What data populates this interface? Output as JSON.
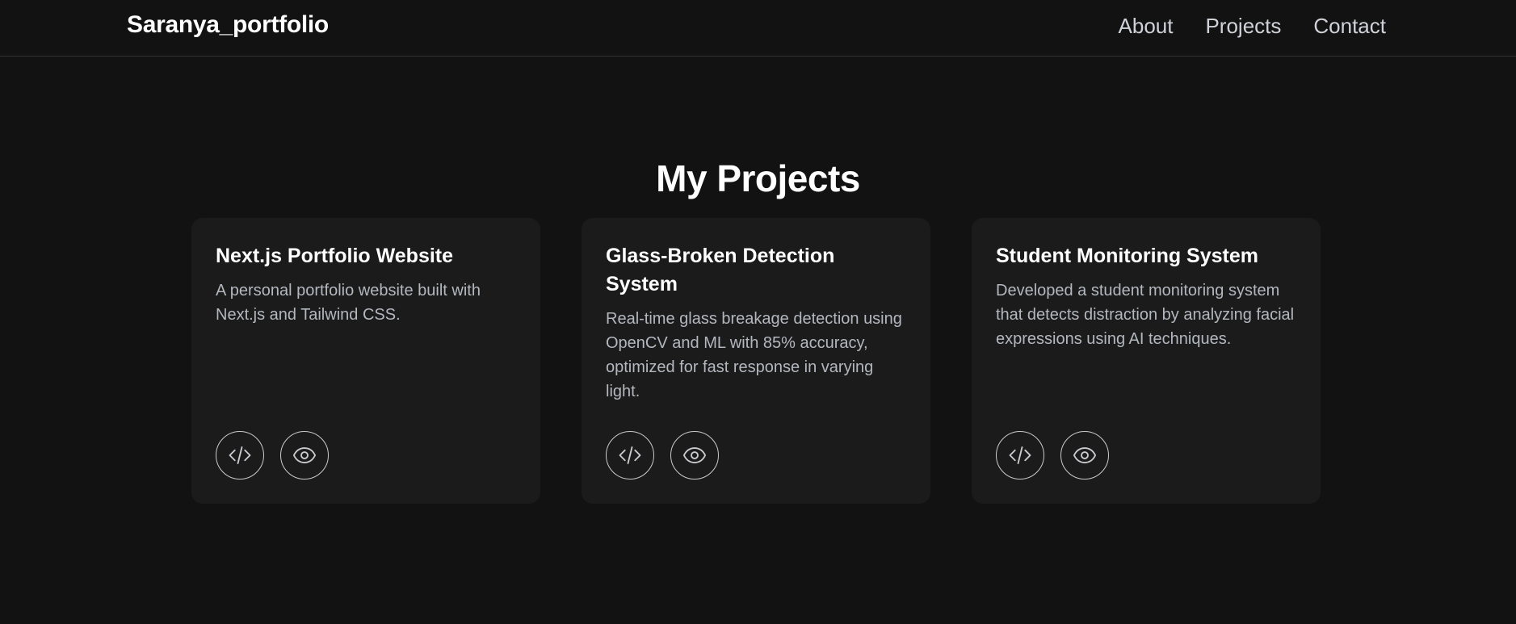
{
  "header": {
    "brand": "Saranya_portfolio",
    "nav": [
      {
        "label": "About"
      },
      {
        "label": "Projects"
      },
      {
        "label": "Contact"
      }
    ]
  },
  "main": {
    "title": "My Projects",
    "projects": [
      {
        "title": "Next.js Portfolio Website",
        "description": "A personal portfolio website built with Next.js and Tailwind CSS.",
        "actions": [
          {
            "icon": "code-icon"
          },
          {
            "icon": "eye-icon"
          }
        ]
      },
      {
        "title": "Glass-Broken Detection System",
        "description": "Real-time glass breakage detection using OpenCV and ML with 85% accuracy, optimized for fast response in varying light.",
        "actions": [
          {
            "icon": "code-icon"
          },
          {
            "icon": "eye-icon"
          }
        ]
      },
      {
        "title": "Student Monitoring System",
        "description": "Developed a student monitoring system that detects distraction by analyzing facial expressions using AI techniques.",
        "actions": [
          {
            "icon": "code-icon"
          },
          {
            "icon": "eye-icon"
          }
        ]
      }
    ]
  },
  "colors": {
    "background": "#121212",
    "card": "#1b1b1b",
    "text": "#ffffff",
    "muted": "#b3b7be"
  }
}
